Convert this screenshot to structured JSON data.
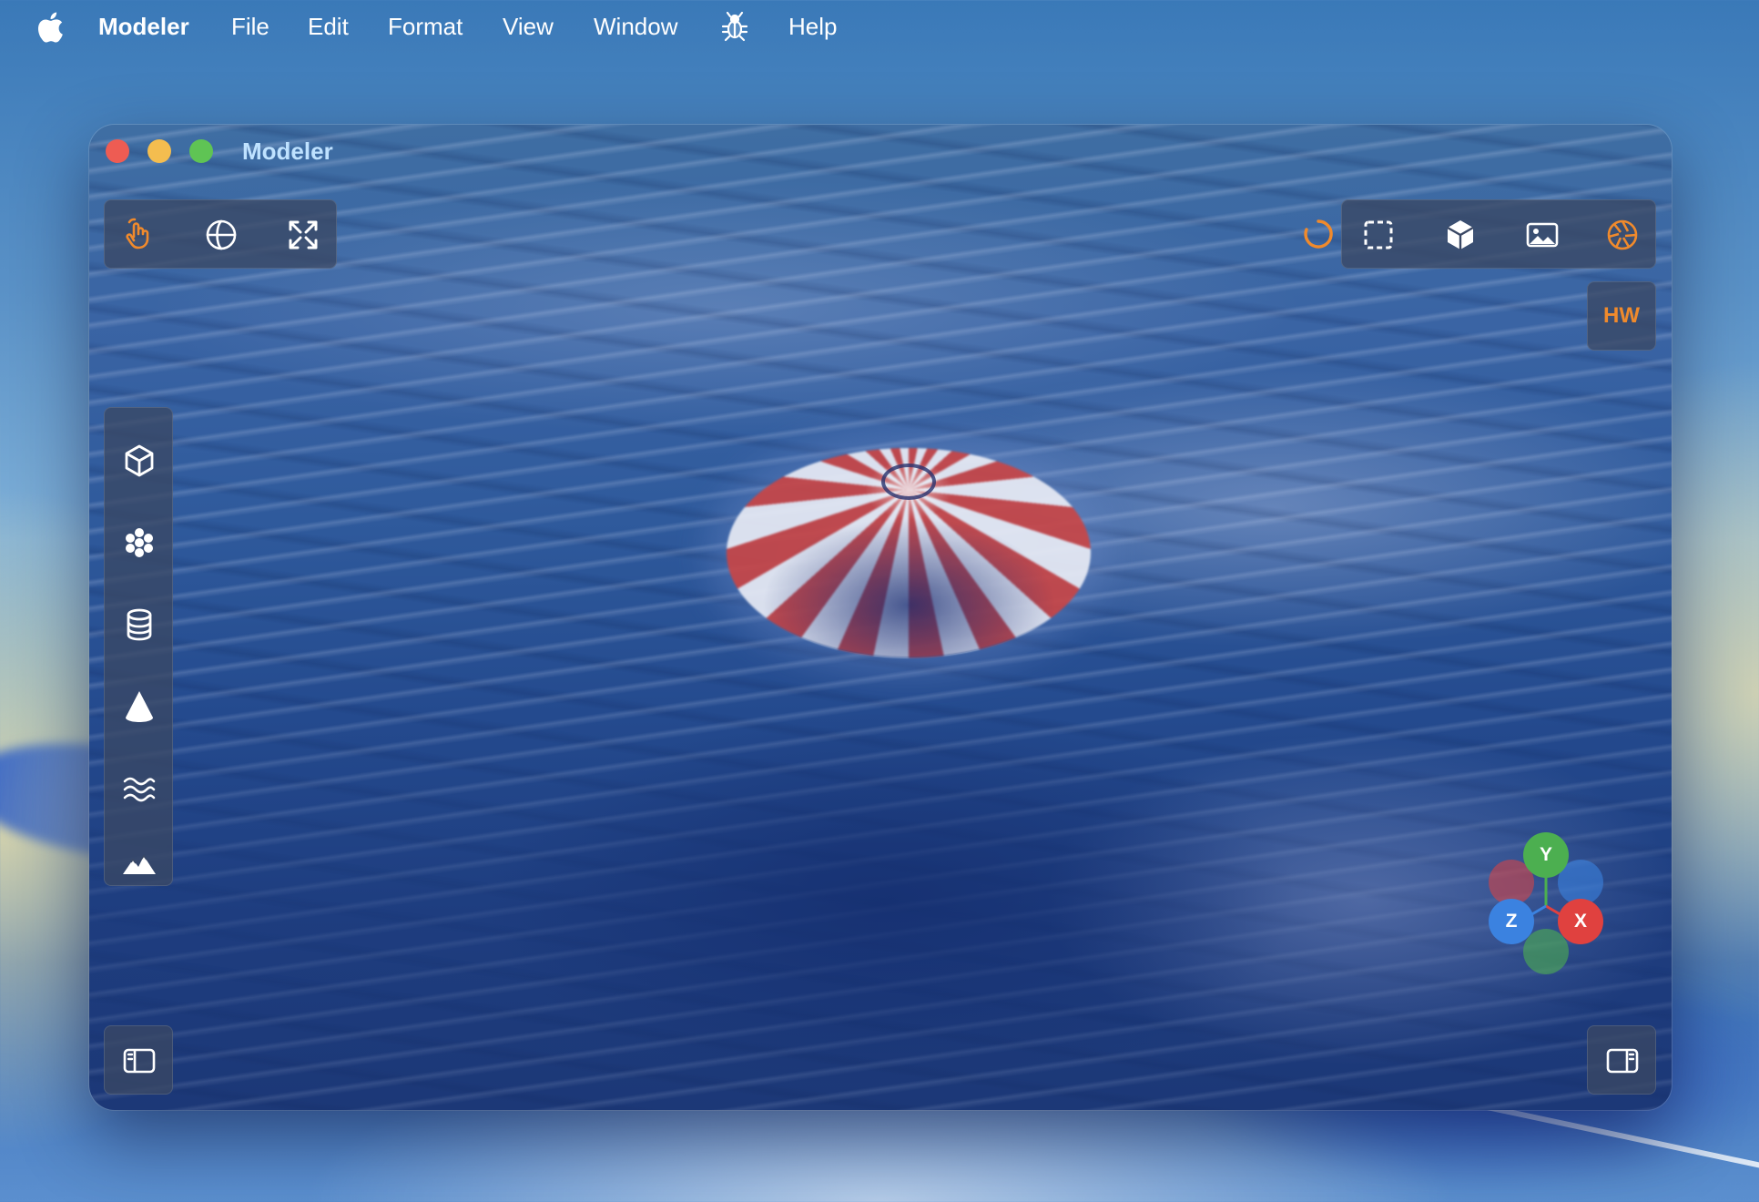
{
  "menubar": {
    "app_name": "Modeler",
    "items": [
      "File",
      "Edit",
      "Format",
      "View",
      "Window",
      "Help"
    ],
    "icons": [
      "apple-icon",
      "bug-icon"
    ]
  },
  "window": {
    "title": "Modeler",
    "hw_badge": "HW",
    "colors": {
      "accent": "#f08a2c",
      "title": "#bfe2ff",
      "panel": "#3a4864",
      "close": "#ee5c53",
      "minimize": "#f4bd4f",
      "maximize": "#5fc454"
    },
    "top_left_tools": [
      "hand-pan-icon",
      "globe-orbit-icon",
      "fit-expand-icon"
    ],
    "top_right_tools": [
      "loading-spinner-icon",
      "selection-box-icon",
      "solid-cube-icon",
      "image-render-icon",
      "aperture-camera-icon"
    ],
    "left_tools": [
      "cube-outline-icon",
      "particles-icon",
      "cylinder-icon",
      "cone-icon",
      "water-waves-icon",
      "terrain-icon"
    ],
    "bottom_left": "left-sidebar-toggle-icon",
    "bottom_right": "right-sidebar-toggle-icon",
    "gizmo": {
      "y_label": "Y",
      "x_label": "X",
      "z_label": "Z",
      "colors": {
        "y": "#4caf50",
        "x": "#e0413f",
        "z": "#3b82e0"
      }
    }
  }
}
